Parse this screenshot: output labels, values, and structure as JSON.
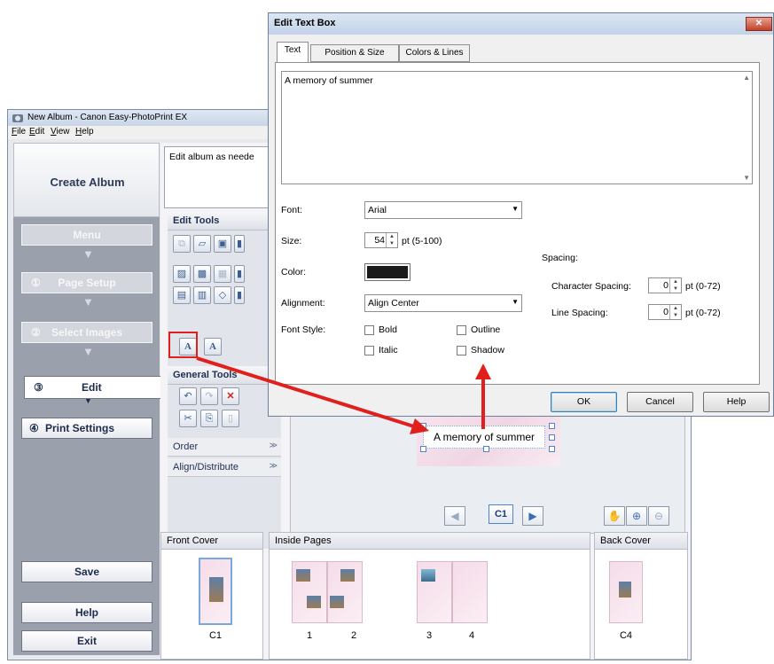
{
  "main_window": {
    "title": "New Album - Canon Easy-PhotoPrint EX",
    "menu": [
      {
        "label": "File",
        "ul": "F",
        "rest": "ile"
      },
      {
        "label": "Edit",
        "ul": "E",
        "rest": "dit"
      },
      {
        "label": "View",
        "ul": "V",
        "rest": "iew"
      },
      {
        "label": "Help",
        "ul": "H",
        "rest": "elp"
      }
    ]
  },
  "nav": {
    "title": "Create Album",
    "menu": "Menu",
    "page_setup": {
      "num": "①",
      "label": "Page Setup"
    },
    "select_images": {
      "num": "②",
      "label": "Select Images"
    },
    "edit": {
      "num": "③",
      "label": "Edit"
    },
    "print_settings": {
      "num": "④",
      "label": "Print Settings"
    },
    "save": "Save",
    "help": "Help",
    "exit": "Exit"
  },
  "guide_text": "Edit album as neede",
  "edit_tools": {
    "heading": "Edit Tools",
    "general_heading": "General Tools",
    "order_label": "Order",
    "align_label": "Align/Distribute"
  },
  "preview": {
    "text_box": "A memory of summer",
    "page_indicator": "C1"
  },
  "thumbnails": {
    "front_cover": {
      "heading": "Front Cover",
      "label": "C1"
    },
    "inside_pages": {
      "heading": "Inside Pages",
      "labels": [
        "1",
        "2",
        "3",
        "4"
      ]
    },
    "back_cover": {
      "heading": "Back Cover",
      "label": "C4"
    }
  },
  "dialog": {
    "title": "Edit Text Box",
    "close": "✕",
    "tabs": [
      "Text",
      "Position & Size",
      "Colors & Lines"
    ],
    "text_value": "A memory of summer",
    "font_label": "Font:",
    "font_value": "Arial",
    "size_label": "Size:",
    "size_value": "54",
    "size_range": "pt (5-100)",
    "color_label": "Color:",
    "color_value": "#1a1a1a",
    "alignment_label": "Alignment:",
    "alignment_value": "Align Center",
    "font_style_label": "Font Style:",
    "bold": "Bold",
    "italic": "Italic",
    "outline": "Outline",
    "shadow": "Shadow",
    "spacing_label": "Spacing:",
    "char_spacing_label": "Character Spacing:",
    "char_spacing_value": "0",
    "char_spacing_range": "pt (0-72)",
    "line_spacing_label": "Line Spacing:",
    "line_spacing_value": "0",
    "line_spacing_range": "pt (0-72)",
    "ok": "OK",
    "cancel": "Cancel",
    "help": "Help"
  },
  "colors": {
    "annotation_red": "#e0201c",
    "accent_blue": "#3c7fb1"
  }
}
